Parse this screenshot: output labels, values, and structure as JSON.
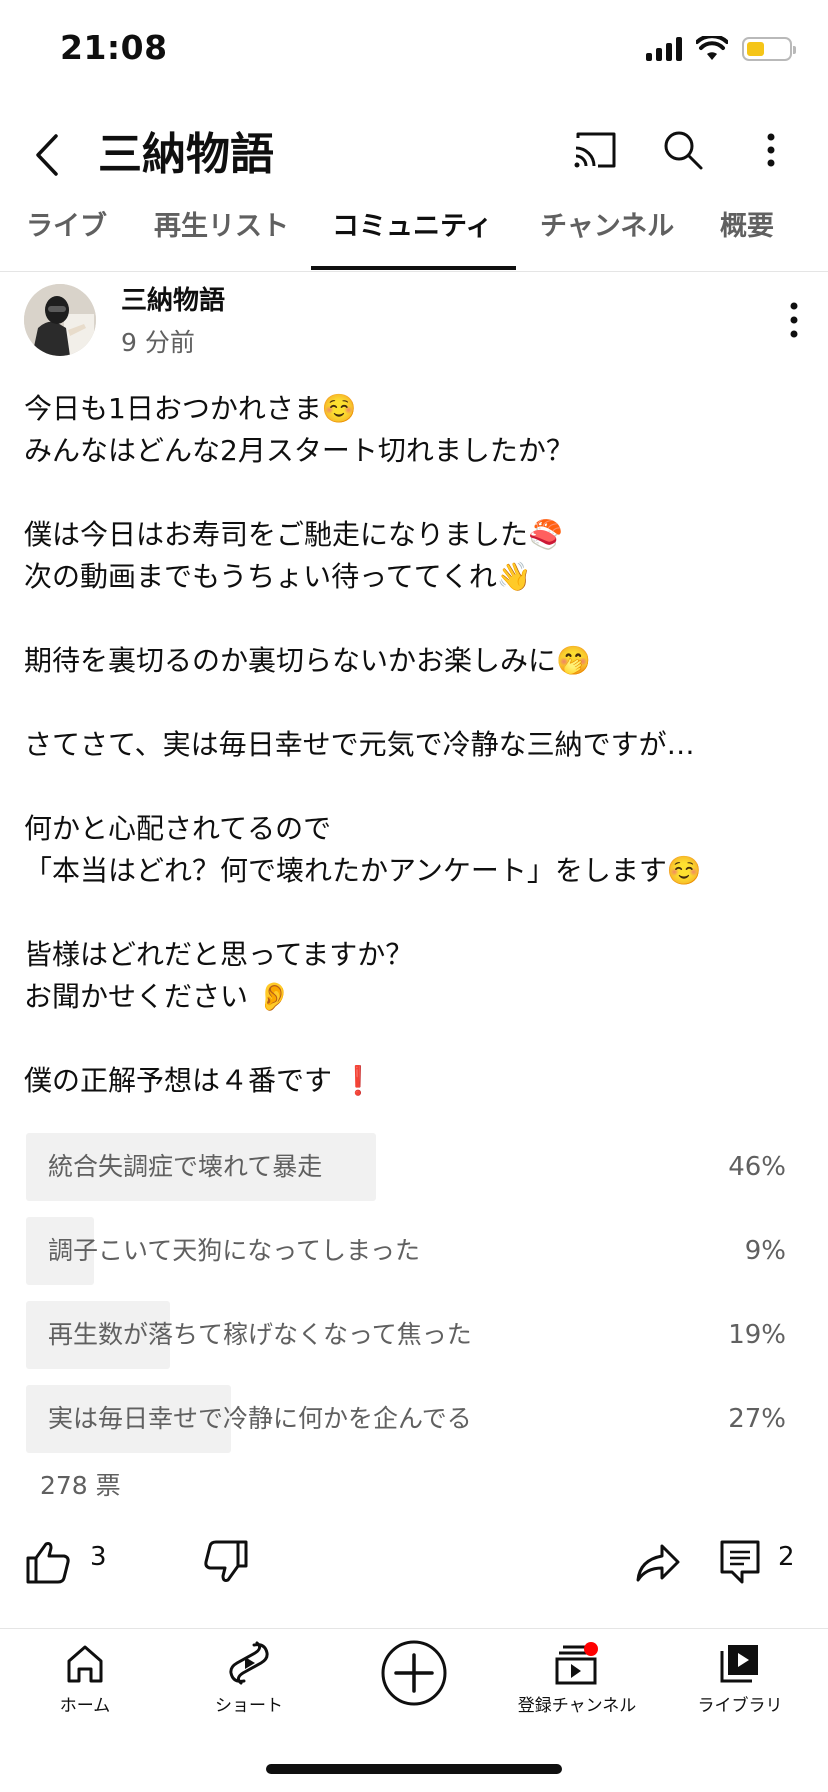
{
  "status_bar": {
    "time": "21:08",
    "battery_color": "#f5c518"
  },
  "header": {
    "title": "三納物語",
    "icons": [
      "back-icon",
      "cast-icon",
      "search-icon",
      "more-vert-icon"
    ]
  },
  "tabs": [
    {
      "label": "ライブ",
      "active": false
    },
    {
      "label": "再生リスト",
      "active": false
    },
    {
      "label": "コミュニティ",
      "active": true
    },
    {
      "label": "チャンネル",
      "active": false
    },
    {
      "label": "概要",
      "active": false
    }
  ],
  "post": {
    "author": "三納物語",
    "time": "9 分前",
    "lines": [
      "今日も1日おつかれさま☺️",
      "みんなはどんな2月スタート切れましたか？",
      "",
      "僕は今日はお寿司をご馳走になりました🍣",
      "次の動画までもうちょい待っててくれ👋",
      "",
      "期待を裏切るのか裏切らないかお楽しみに🤭",
      "",
      "さてさて、実は毎日幸せで元気で冷静な三納ですが…",
      "",
      "何かと心配されてるので",
      "「本当はどれ？何で壊れたかアンケート」をします☺️",
      "",
      "皆様はどれだと思ってますか？",
      "お聞かせください 👂",
      "",
      "僕の正解予想は４番です ❗"
    ]
  },
  "poll": {
    "options": [
      {
        "label": "統合失調症で壊れて暴走",
        "percent": "46%",
        "fraction": 0.46
      },
      {
        "label": "調子こいて天狗になってしまった",
        "percent": "9%",
        "fraction": 0.09
      },
      {
        "label": "再生数が落ちて稼げなくなって焦った",
        "percent": "19%",
        "fraction": 0.19
      },
      {
        "label": "実は毎日幸せで冷静に何かを企んでる",
        "percent": "27%",
        "fraction": 0.27
      }
    ],
    "votes": "278 票"
  },
  "actions": {
    "likes": "3",
    "comments": "2"
  },
  "bottom_nav": {
    "items": [
      {
        "label": "ホーム",
        "icon": "home-icon"
      },
      {
        "label": "ショート",
        "icon": "shorts-icon"
      },
      {
        "label": "",
        "icon": "create-icon"
      },
      {
        "label": "登録チャンネル",
        "icon": "subscriptions-icon"
      },
      {
        "label": "ライブラリ",
        "icon": "library-icon"
      }
    ],
    "notification_color": "#ff0000"
  }
}
